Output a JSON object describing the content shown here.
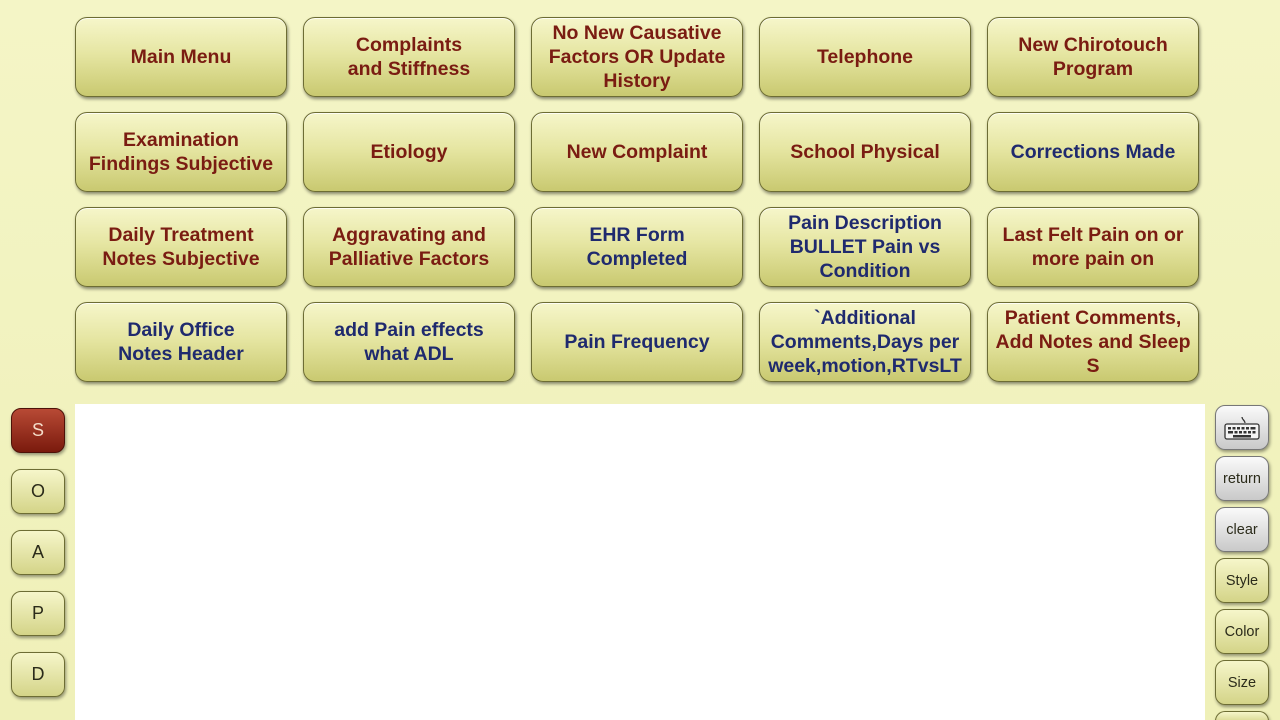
{
  "macro_buttons": [
    {
      "label": "Main Menu",
      "color": "#7a1c12"
    },
    {
      "label": "Complaints\nand Stiffness",
      "color": "#7a1c12"
    },
    {
      "label": "No New Causative\nFactors OR Update\nHistory",
      "color": "#7a1c12"
    },
    {
      "label": "Telephone",
      "color": "#7a1c12"
    },
    {
      "label": "New Chirotouch\nProgram",
      "color": "#7a1c12"
    },
    {
      "label": "Examination\nFindings Subjective",
      "color": "#7a1c12"
    },
    {
      "label": "Etiology",
      "color": "#7a1c12"
    },
    {
      "label": "New Complaint",
      "color": "#7a1c12"
    },
    {
      "label": "School Physical",
      "color": "#7a1c12"
    },
    {
      "label": "Corrections Made",
      "color": "#1f2a6e"
    },
    {
      "label": "Daily Treatment\nNotes Subjective",
      "color": "#7a1c12"
    },
    {
      "label": "Aggravating and\nPalliative Factors",
      "color": "#7a1c12"
    },
    {
      "label": "EHR Form\nCompleted",
      "color": "#1f2a6e"
    },
    {
      "label": "Pain Description\nBULLET Pain vs\nCondition",
      "color": "#1f2a6e"
    },
    {
      "label": "Last Felt Pain on or\nmore pain on",
      "color": "#7a1c12"
    },
    {
      "label": "Daily Office\nNotes Header",
      "color": "#1f2a6e"
    },
    {
      "label": "add Pain effects\nwhat ADL",
      "color": "#1f2a6e"
    },
    {
      "label": "Pain Frequency",
      "color": "#1f2a6e"
    },
    {
      "label": "`Additional\nComments,Days per\nweek,motion,RTvsLT",
      "color": "#1f2a6e"
    },
    {
      "label": "Patient Comments,\nAdd Notes and Sleep\nS",
      "color": "#7a1c12"
    }
  ],
  "soap_tabs": {
    "s": "S",
    "o": "O",
    "a": "A",
    "p": "P",
    "d": "D",
    "active": "S"
  },
  "tools": {
    "keyboard_icon": "keyboard-icon",
    "return_label": "return",
    "clear_label": "clear",
    "style_label": "Style",
    "color_label": "Color",
    "size_label": "Size"
  },
  "editor": {
    "content": ""
  }
}
